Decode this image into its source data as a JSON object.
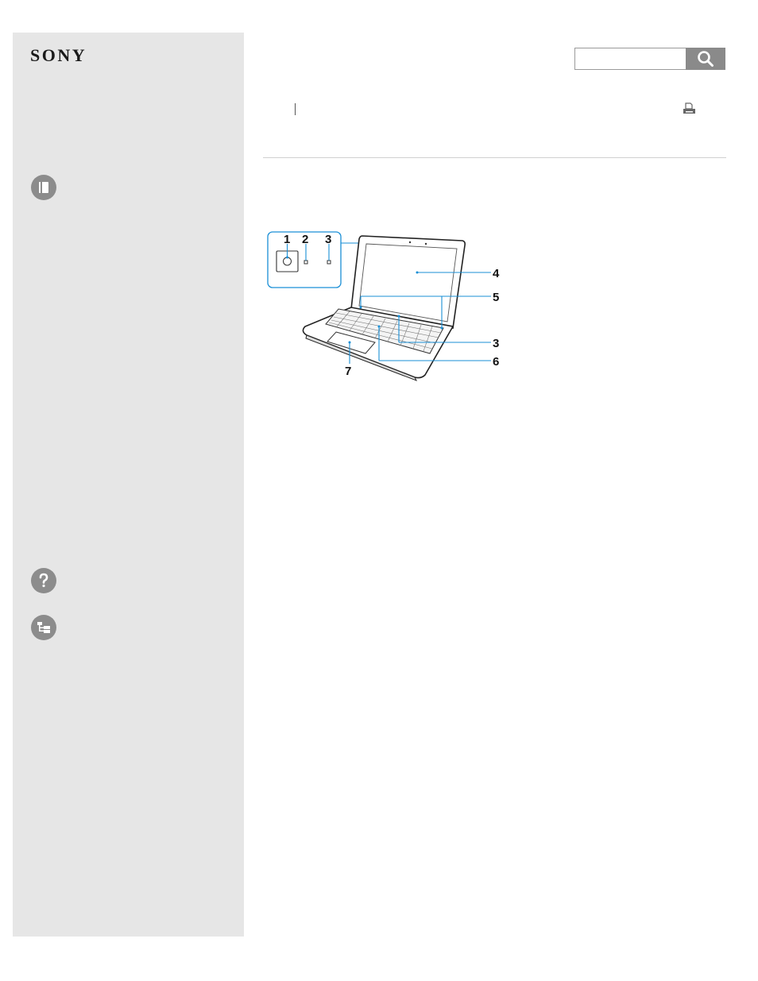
{
  "brand": {
    "logo_text": "SONY"
  },
  "search": {
    "placeholder": "",
    "button_icon": "search-icon"
  },
  "toolbar": {
    "print_icon": "print-icon"
  },
  "sidebar": {
    "items": [
      {
        "icon": "book-icon"
      },
      {
        "icon": "help-icon"
      },
      {
        "icon": "tree-icon"
      }
    ]
  },
  "figure": {
    "callouts": [
      "1",
      "2",
      "3",
      "4",
      "5",
      "3",
      "6",
      "7"
    ]
  },
  "colors": {
    "sidebar_bg": "#e6e6e6",
    "icon_gray": "#8c8c8c",
    "callout_blue": "#1a8fd6"
  }
}
